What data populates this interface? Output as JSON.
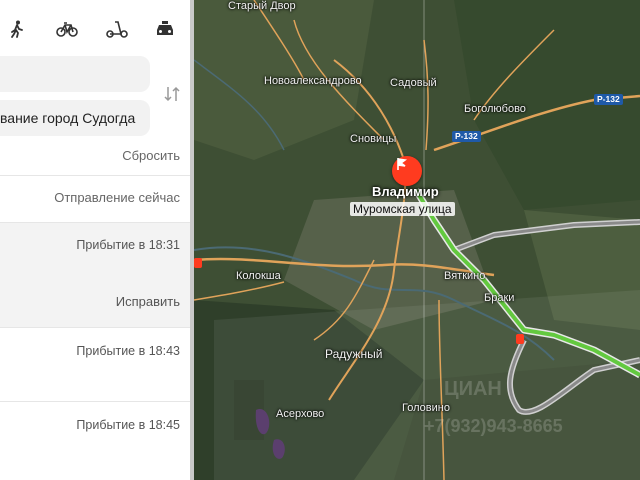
{
  "transport_modes": [
    {
      "name": "walk",
      "icon": "walking-person-icon"
    },
    {
      "name": "bicycle",
      "icon": "bicycle-icon"
    },
    {
      "name": "scooter",
      "icon": "scooter-icon"
    },
    {
      "name": "taxi",
      "icon": "taxi-icon"
    }
  ],
  "route_form": {
    "from_value": "",
    "to_value": "вание город Судогда",
    "reset_label": "Сбросить",
    "departure_label": "Отправление сейчас"
  },
  "routes": [
    {
      "arrival": "Прибытие в 18:31",
      "action": "Исправить"
    },
    {
      "arrival": "Прибытие в 18:43"
    },
    {
      "arrival": "Прибытие в 18:45"
    }
  ],
  "map": {
    "places": {
      "stary_dvor": "Старый Двор",
      "novoaleksandrovo": "Новоалександрово",
      "sadovy": "Садовый",
      "bogolyubovo": "Боголюбово",
      "snovitsy": "Сновицы",
      "koloksha": "Колокша",
      "vyatkino": "Вяткино",
      "ibraki": "Браки",
      "raduzhny": "Радужный",
      "aserkhovo": "Асерхово",
      "golovino": "Головино"
    },
    "city": "Владимир",
    "street": "Муромская улица",
    "road_badges": [
      "Р-132",
      "Р-132"
    ],
    "watermark_text": "+7(932)943-8665",
    "watermark_logo": "ЦИАН"
  },
  "colors": {
    "route_active": "#63c93f",
    "route_alt": "#bdbdbd",
    "road": "#e0a35a",
    "pin": "#ff3b1f"
  }
}
